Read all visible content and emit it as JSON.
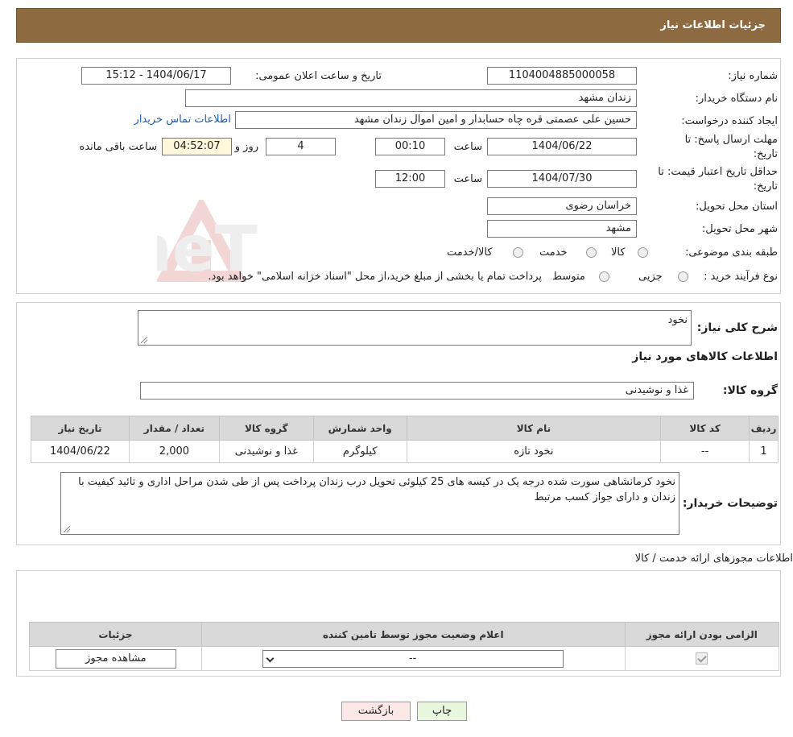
{
  "header": {
    "title": "جزئیات اطلاعات نیاز"
  },
  "watermark": {
    "text": "AriaTender.neT"
  },
  "form": {
    "need_number_label": "شماره نیاز:",
    "need_number": "1104004885000058",
    "announce_label": "تاریخ و ساعت اعلان عمومی:",
    "announce_value": "1404/06/17 - 15:12",
    "buyer_org_label": "نام دستگاه خریدار:",
    "buyer_org": "زندان مشهد",
    "requester_label": "ایجاد کننده درخواست:",
    "requester": "حسین علی عصمتی قره چاه حسابدار و امین اموال زندان مشهد",
    "contact_link": "اطلاعات تماس خریدار",
    "deadline_label_1": "مهلت ارسال پاسخ: تا",
    "deadline_label_2": "تاریخ:",
    "deadline_date": "1404/06/22",
    "time_label": "ساعت",
    "deadline_time": "00:10",
    "days_value": "4",
    "days_suffix": "روز و",
    "remaining_time": "04:52:07",
    "remaining_label": "ساعت باقی مانده",
    "validity_label_1": "حداقل تاریخ اعتبار قیمت: تا",
    "validity_label_2": "تاریخ:",
    "validity_date": "1404/07/30",
    "validity_time": "12:00",
    "province_label": "استان محل تحویل:",
    "province": "خراسان رضوی",
    "city_label": "شهر محل تحویل:",
    "city": "مشهد",
    "category_label": "طبقه بندی موضوعی:",
    "category_options": [
      "کالا",
      "خدمت",
      "کالا/خدمت"
    ],
    "process_label": "نوع فرآیند خرید :",
    "process_options": [
      "جزیی",
      "متوسط"
    ],
    "process_note": "پرداخت تمام یا بخشی از مبلغ خرید،از محل \"اسناد خزانه اسلامی\" خواهد بود."
  },
  "goods": {
    "desc_label": "شرح کلی نیاز:",
    "desc_value": "نخود",
    "section_title": "اطلاعات کالاهای مورد نیاز",
    "group_label": "گروه کالا:",
    "group_value": "غذا و نوشیدنی",
    "columns": [
      "ردیف",
      "کد کالا",
      "نام کالا",
      "واحد شمارش",
      "گروه کالا",
      "تعداد / مقدار",
      "تاریخ نیاز"
    ],
    "rows": [
      [
        "1",
        "--",
        "نخود تازه",
        "کیلوگرم",
        "غذا و نوشیدنی",
        "2,000",
        "1404/06/22"
      ]
    ],
    "buyer_notes_label": "توضیحات خریدار:",
    "buyer_notes": "نخود کرمانشاهی سورت شده درجه یک در کیسه های 25 کیلوئی تحویل درب زندان پرداخت پس از طی شدن مراحل اداری و تائید کیفیت با زندان و دارای جواز کسب مرتبط"
  },
  "permits": {
    "title": "اطلاعات مجوزهای ارائه خدمت / کالا",
    "columns": [
      "الزامی بودن ارائه مجوز",
      "اعلام وضعیت مجوز توسط تامین کننده",
      "جزئیات"
    ],
    "select_value": "--",
    "view_button": "مشاهده مجوز"
  },
  "actions": {
    "print": "چاپ",
    "back": "بازگشت"
  }
}
